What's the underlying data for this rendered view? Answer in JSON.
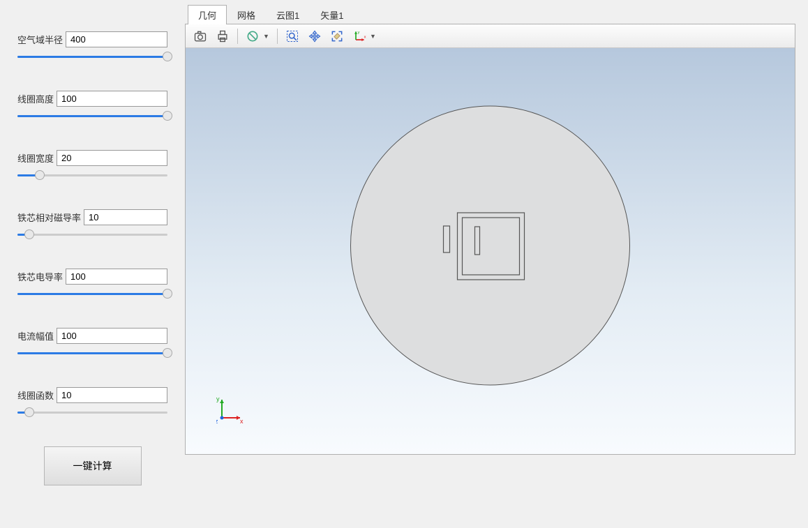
{
  "params": [
    {
      "label": "空气域半径",
      "value": "400",
      "fill": 100
    },
    {
      "label": "线圈高度",
      "value": "100",
      "fill": 100
    },
    {
      "label": "线圈宽度",
      "value": "20",
      "fill": 15
    },
    {
      "label": "铁芯相对磁导率",
      "value": "10",
      "fill": 8
    },
    {
      "label": "铁芯电导率",
      "value": "100",
      "fill": 100
    },
    {
      "label": "电流幅值",
      "value": "100",
      "fill": 100
    },
    {
      "label": "线圈函数",
      "value": "10",
      "fill": 8
    }
  ],
  "calc_button": "一键计算",
  "tabs": [
    {
      "label": "几何",
      "active": true
    },
    {
      "label": "网格",
      "active": false
    },
    {
      "label": "云图1",
      "active": false
    },
    {
      "label": "矢量1",
      "active": false
    }
  ],
  "toolbar_icons": [
    "camera-icon",
    "print-icon",
    "sep",
    "prohibit-icon",
    "dd",
    "sep",
    "zoom-box-icon",
    "pan-icon",
    "fit-icon",
    "axis-icon",
    "dd"
  ],
  "axis_labels": {
    "x": "x",
    "y": "y",
    "z": "z"
  }
}
